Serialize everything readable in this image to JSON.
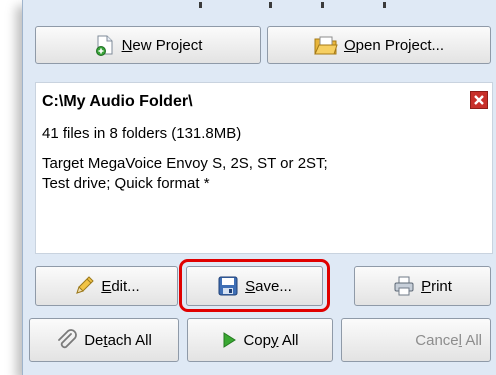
{
  "toolbar": {
    "new_project_pre": "",
    "new_project_key": "N",
    "new_project_post": "ew Project",
    "open_project_pre": "",
    "open_project_key": "O",
    "open_project_post": "pen Project..."
  },
  "info": {
    "folder": "C:\\My Audio Folder\\",
    "files": "41 files in 8 folders (131.8MB)",
    "target_line1": "Target MegaVoice Envoy S, 2S, ST or 2ST;",
    "target_line2": "Test drive; Quick format *"
  },
  "actions": {
    "edit_pre": "",
    "edit_key": "E",
    "edit_post": "dit...",
    "save_pre": "",
    "save_key": "S",
    "save_post": "ave...",
    "print_pre": "",
    "print_key": "P",
    "print_post": "rint",
    "detach_pre": "De",
    "detach_key": "t",
    "detach_post": "ach All",
    "copy_pre": "Cop",
    "copy_key": "y",
    "copy_post": " All",
    "cancel_pre": "Cance",
    "cancel_key": "l",
    "cancel_post": " All"
  },
  "colors": {
    "panel_bg": "#dfe9f5",
    "highlight": "#e00000",
    "close": "#c8302a",
    "play_green": "#3aa832"
  }
}
